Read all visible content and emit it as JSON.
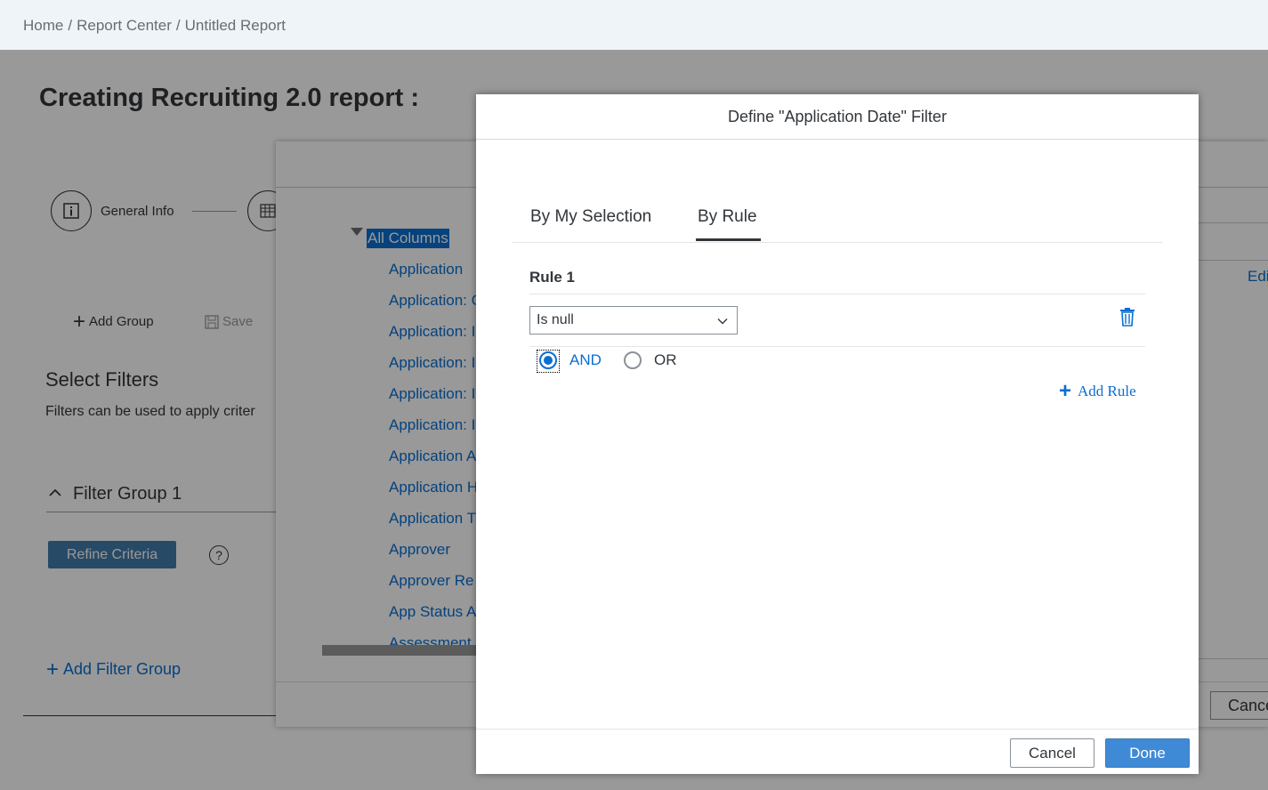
{
  "breadcrumb": [
    "Home",
    "Report Center",
    "Untitled Report"
  ],
  "page": {
    "title": "Creating Recruiting 2.0 report :",
    "step1_label": "General Info",
    "add_group": "Add Group",
    "save": "Save",
    "select_filters": "Select Filters",
    "filters_desc": "Filters can be used to apply criter",
    "filter_group": "Filter Group 1",
    "refine_criteria": "Refine Criteria",
    "add_filter_group": "Add Filter Group"
  },
  "middle_dialog": {
    "tree_root": "All Columns",
    "tree_items": [
      "Application",
      "Application: C",
      "Application: I",
      "Application: I",
      "Application: I",
      "Application: I",
      "Application A",
      "Application H",
      "Application T",
      "Approver",
      "Approver Re",
      "App Status A",
      "Assessment"
    ],
    "edit": "Edi",
    "cancel": "Cance"
  },
  "dialog": {
    "title": "Define \"Application Date\" Filter",
    "tabs": [
      "By My Selection",
      "By Rule"
    ],
    "active_tab": "By Rule",
    "rule_title": "Rule 1",
    "rule_operator": "Is null",
    "radio_and": "AND",
    "radio_or": "OR",
    "radio_selected": "AND",
    "add_rule": "Add Rule",
    "cancel": "Cancel",
    "done": "Done"
  },
  "colors": {
    "accent": "#0a6ed1",
    "primary_button": "#3f8ad7",
    "refine_button": "#427cac"
  }
}
